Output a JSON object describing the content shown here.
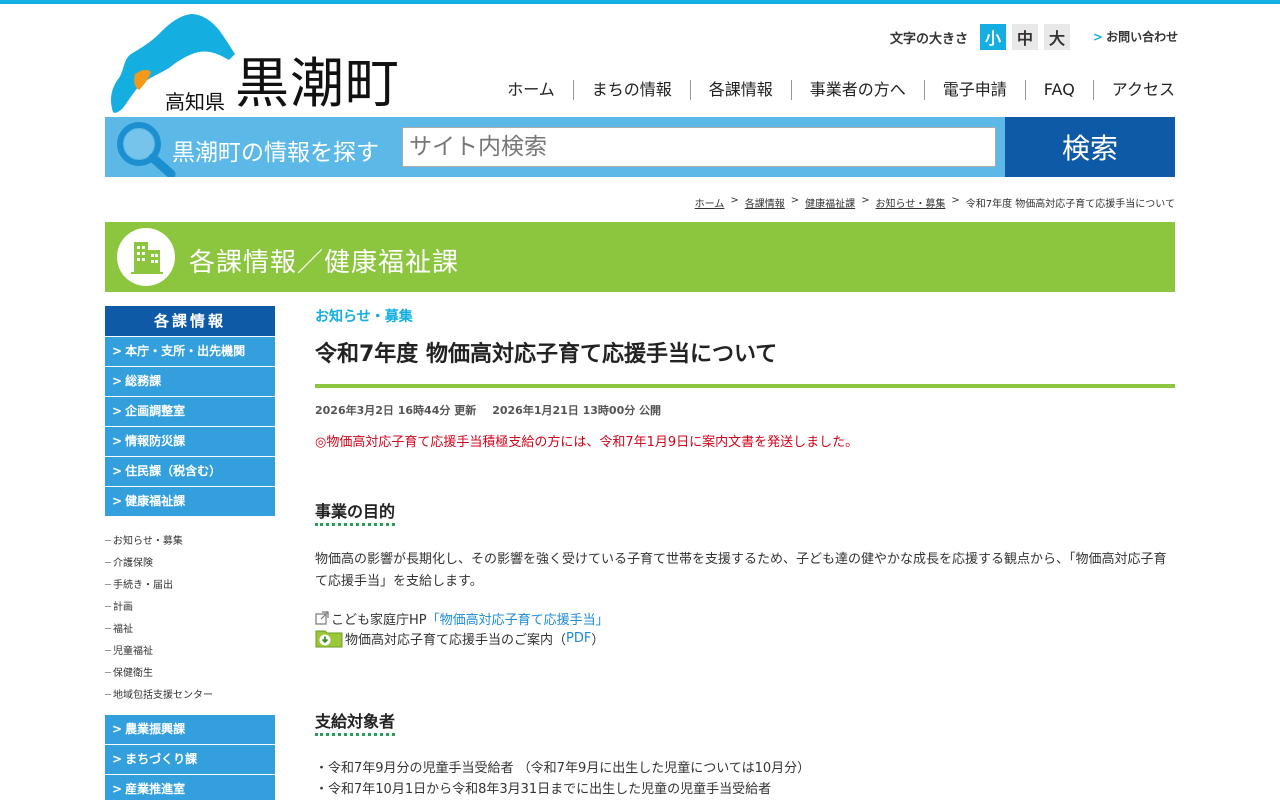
{
  "header": {
    "logo_pref": "高知県",
    "logo_town": "黒潮町",
    "fontsize_label": "文字の大きさ",
    "fontsize_options": [
      "小",
      "中",
      "大"
    ],
    "fontsize_active": "小",
    "contact": "お問い合わせ",
    "nav": [
      "ホーム",
      "まちの情報",
      "各課情報",
      "事業者の方へ",
      "電子申請",
      "FAQ",
      "アクセス"
    ]
  },
  "search": {
    "label": "黒潮町の情報を探す",
    "placeholder": "サイト内検索",
    "button": "検索"
  },
  "breadcrumb": {
    "items": [
      "ホーム",
      "各課情報",
      "健康福祉課",
      "お知らせ・募集"
    ],
    "current": "令和7年度 物価高対応子育て応援手当について"
  },
  "banner": {
    "title": "各課情報／健康福祉課"
  },
  "sidebar": {
    "heading": "各課情報",
    "items_top": [
      "本庁・支所・出先機関",
      "総務課",
      "企画調整室",
      "情報防災課",
      "住民課（税含む）",
      "健康福祉課"
    ],
    "sub_items": [
      "お知らせ・募集",
      "介護保険",
      "手続き・届出",
      "計画",
      "福祉",
      "児童福祉",
      "保健衛生",
      "地域包括支援センター"
    ],
    "items_bottom": [
      "農業振興課",
      "まちづくり課",
      "産業推進室"
    ]
  },
  "article": {
    "category": "お知らせ・募集",
    "title": "令和7年度 物価高対応子育て応援手当について",
    "updated": "2026年3月2日 16時44分 更新",
    "published": "2026年1月21日 13時00分 公開",
    "notice": "◎物価高対応子育て応援手当積極支給の方には、令和7年1月9日に案内文書を発送しました。",
    "section1_heading": "事業の目的",
    "section1_text": "物価高の影響が長期化し、その影響を強く受けている子育て世帯を支援するため、子ども達の健やかな成長を応援する観点から、「物価高対応子育て応援手当」を支給します。",
    "link1_prefix": "こども家庭庁HP",
    "link1_text": "「物価高対応子育て応援手当」",
    "link2_prefix": "物価高対応子育て応援手当のご案内（",
    "link2_text": "PDF",
    "link2_suffix": "）",
    "section2_heading": "支給対象者",
    "section2_items": [
      "・令和7年9月分の児童手当受給者 （令和7年9月に出生した児童については10月分）",
      "・令和7年10月1日から令和8年3月31日までに出生した児童の児童手当受給者"
    ]
  },
  "colors": {
    "accent": "#14aee0",
    "navy": "#0f5aa6",
    "green": "#8cc63f",
    "notice_red": "#d0021b"
  }
}
